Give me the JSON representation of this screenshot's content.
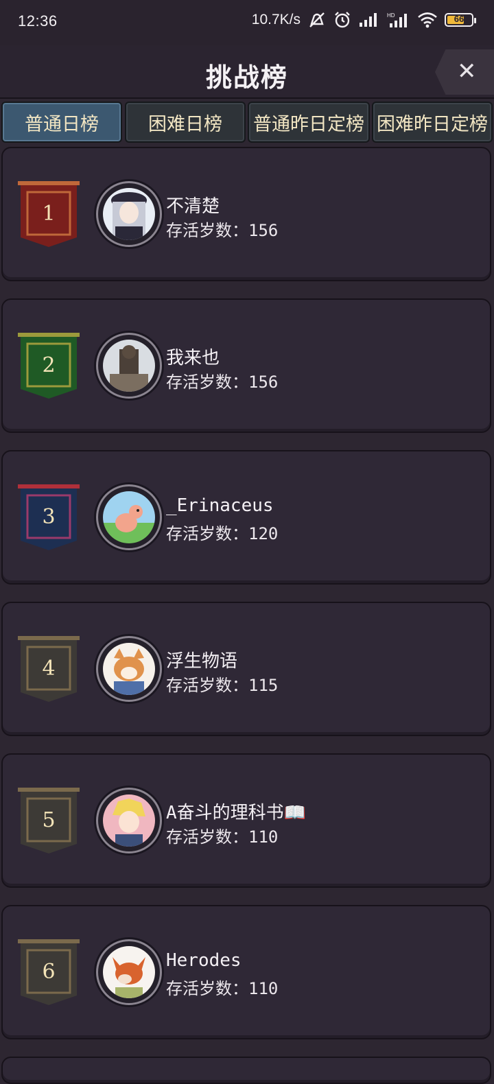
{
  "status_bar": {
    "time": "12:36",
    "net_speed": "10.7K/s",
    "battery": "66",
    "icons": [
      "mute-icon",
      "alarm-icon",
      "signal-icon",
      "signal-hd-icon",
      "wifi-icon",
      "battery-icon"
    ]
  },
  "header": {
    "title": "挑战榜",
    "close_icon": "close-icon",
    "close_label": "✕"
  },
  "tabs": [
    {
      "label": "普通日榜",
      "active": true
    },
    {
      "label": "困难日榜",
      "active": false
    },
    {
      "label": "普通昨日定榜",
      "active": false
    },
    {
      "label": "困难昨日定榜",
      "active": false
    }
  ],
  "entries": [
    {
      "rank": "1",
      "name": "不清楚",
      "score": "存活岁数：156",
      "banner_color": "#7a1f1c",
      "banner_border": "#c0683a",
      "avatar_icon": "anime-girl-avatar"
    },
    {
      "rank": "2",
      "name": "我来也",
      "score": "存活岁数：156",
      "banner_color": "#1f5a25",
      "banner_border": "#9c9a3c",
      "avatar_icon": "statue-avatar"
    },
    {
      "rank": "3",
      "name": "_Erinaceus",
      "score": "存活岁数：120",
      "banner_color": "#1d2f52",
      "banner_border": "#9a3a6a",
      "avatar_icon": "duck-avatar"
    },
    {
      "rank": "4",
      "name": "浮生物语",
      "score": "存活岁数：115",
      "banner_color": "#3d3a36",
      "banner_border": "#7b6a4c",
      "avatar_icon": "shiba-avatar"
    },
    {
      "rank": "5",
      "name": "A奋斗的理科书📖",
      "score": "存活岁数：110",
      "banner_color": "#3d3a36",
      "banner_border": "#7b6a4c",
      "avatar_icon": "anime-boy-avatar"
    },
    {
      "rank": "6",
      "name": "Herodes",
      "score": "存活岁数：110",
      "banner_color": "#3d3a36",
      "banner_border": "#7b6a4c",
      "avatar_icon": "fox-avatar"
    }
  ]
}
